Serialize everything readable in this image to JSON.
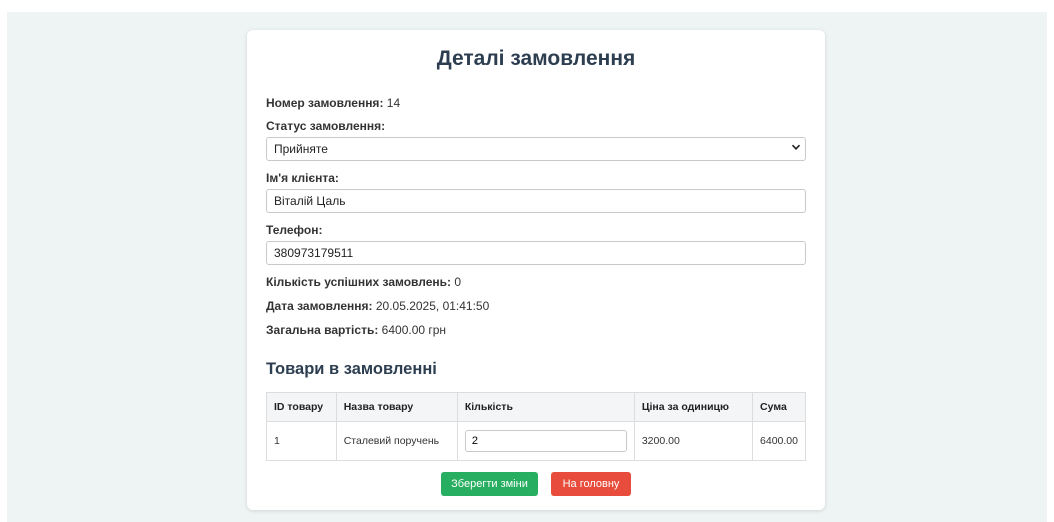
{
  "page": {
    "title": "Деталі замовлення"
  },
  "order": {
    "number_label": "Номер замовлення:",
    "number_value": "14",
    "status_label": "Статус замовлення:",
    "status_value": "Прийняте",
    "client_label": "Ім'я клієнта:",
    "client_value": "Віталій Цаль",
    "phone_label": "Телефон:",
    "phone_value": "380973179511",
    "success_label": "Кількість успішних замовлень:",
    "success_value": "0",
    "date_label": "Дата замовлення:",
    "date_value": "20.05.2025, 01:41:50",
    "total_label": "Загальна вартість:",
    "total_value": "6400.00 грн"
  },
  "items_section": {
    "title": "Товари в замовленні",
    "headers": [
      "ID товару",
      "Назва товару",
      "Кількість",
      "Ціна за одиницю",
      "Сума"
    ],
    "rows": [
      {
        "id": "1",
        "name": "Сталевий поручень",
        "quantity": "2",
        "unit_price": "3200.00",
        "sum": "6400.00"
      }
    ]
  },
  "actions": {
    "save_label": "Зберегти зміни",
    "home_label": "На головну"
  },
  "colors": {
    "save": "#27ae60",
    "home": "#e74c3c",
    "heading": "#2c3e50"
  },
  "icons": {
    "status_dropdown": "chevron-down-icon"
  }
}
